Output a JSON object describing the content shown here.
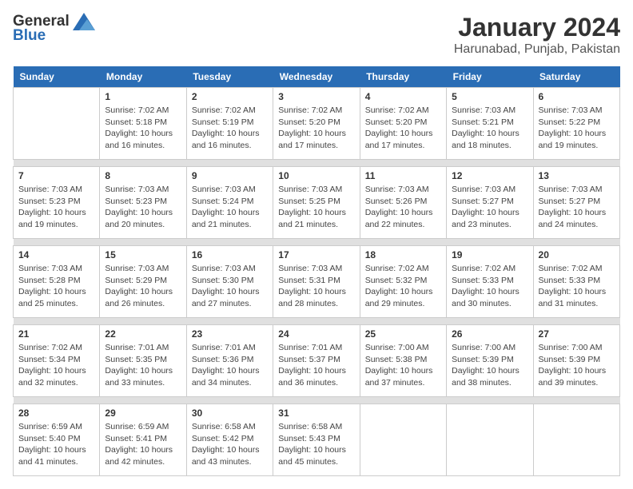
{
  "logo": {
    "general": "General",
    "blue": "Blue"
  },
  "title": "January 2024",
  "subtitle": "Harunabad, Punjab, Pakistan",
  "days_header": [
    "Sunday",
    "Monday",
    "Tuesday",
    "Wednesday",
    "Thursday",
    "Friday",
    "Saturday"
  ],
  "weeks": [
    {
      "days": [
        {
          "num": "",
          "info": ""
        },
        {
          "num": "1",
          "info": "Sunrise: 7:02 AM\nSunset: 5:18 PM\nDaylight: 10 hours\nand 16 minutes."
        },
        {
          "num": "2",
          "info": "Sunrise: 7:02 AM\nSunset: 5:19 PM\nDaylight: 10 hours\nand 16 minutes."
        },
        {
          "num": "3",
          "info": "Sunrise: 7:02 AM\nSunset: 5:20 PM\nDaylight: 10 hours\nand 17 minutes."
        },
        {
          "num": "4",
          "info": "Sunrise: 7:02 AM\nSunset: 5:20 PM\nDaylight: 10 hours\nand 17 minutes."
        },
        {
          "num": "5",
          "info": "Sunrise: 7:03 AM\nSunset: 5:21 PM\nDaylight: 10 hours\nand 18 minutes."
        },
        {
          "num": "6",
          "info": "Sunrise: 7:03 AM\nSunset: 5:22 PM\nDaylight: 10 hours\nand 19 minutes."
        }
      ]
    },
    {
      "days": [
        {
          "num": "7",
          "info": "Sunrise: 7:03 AM\nSunset: 5:23 PM\nDaylight: 10 hours\nand 19 minutes."
        },
        {
          "num": "8",
          "info": "Sunrise: 7:03 AM\nSunset: 5:23 PM\nDaylight: 10 hours\nand 20 minutes."
        },
        {
          "num": "9",
          "info": "Sunrise: 7:03 AM\nSunset: 5:24 PM\nDaylight: 10 hours\nand 21 minutes."
        },
        {
          "num": "10",
          "info": "Sunrise: 7:03 AM\nSunset: 5:25 PM\nDaylight: 10 hours\nand 21 minutes."
        },
        {
          "num": "11",
          "info": "Sunrise: 7:03 AM\nSunset: 5:26 PM\nDaylight: 10 hours\nand 22 minutes."
        },
        {
          "num": "12",
          "info": "Sunrise: 7:03 AM\nSunset: 5:27 PM\nDaylight: 10 hours\nand 23 minutes."
        },
        {
          "num": "13",
          "info": "Sunrise: 7:03 AM\nSunset: 5:27 PM\nDaylight: 10 hours\nand 24 minutes."
        }
      ]
    },
    {
      "days": [
        {
          "num": "14",
          "info": "Sunrise: 7:03 AM\nSunset: 5:28 PM\nDaylight: 10 hours\nand 25 minutes."
        },
        {
          "num": "15",
          "info": "Sunrise: 7:03 AM\nSunset: 5:29 PM\nDaylight: 10 hours\nand 26 minutes."
        },
        {
          "num": "16",
          "info": "Sunrise: 7:03 AM\nSunset: 5:30 PM\nDaylight: 10 hours\nand 27 minutes."
        },
        {
          "num": "17",
          "info": "Sunrise: 7:03 AM\nSunset: 5:31 PM\nDaylight: 10 hours\nand 28 minutes."
        },
        {
          "num": "18",
          "info": "Sunrise: 7:02 AM\nSunset: 5:32 PM\nDaylight: 10 hours\nand 29 minutes."
        },
        {
          "num": "19",
          "info": "Sunrise: 7:02 AM\nSunset: 5:33 PM\nDaylight: 10 hours\nand 30 minutes."
        },
        {
          "num": "20",
          "info": "Sunrise: 7:02 AM\nSunset: 5:33 PM\nDaylight: 10 hours\nand 31 minutes."
        }
      ]
    },
    {
      "days": [
        {
          "num": "21",
          "info": "Sunrise: 7:02 AM\nSunset: 5:34 PM\nDaylight: 10 hours\nand 32 minutes."
        },
        {
          "num": "22",
          "info": "Sunrise: 7:01 AM\nSunset: 5:35 PM\nDaylight: 10 hours\nand 33 minutes."
        },
        {
          "num": "23",
          "info": "Sunrise: 7:01 AM\nSunset: 5:36 PM\nDaylight: 10 hours\nand 34 minutes."
        },
        {
          "num": "24",
          "info": "Sunrise: 7:01 AM\nSunset: 5:37 PM\nDaylight: 10 hours\nand 36 minutes."
        },
        {
          "num": "25",
          "info": "Sunrise: 7:00 AM\nSunset: 5:38 PM\nDaylight: 10 hours\nand 37 minutes."
        },
        {
          "num": "26",
          "info": "Sunrise: 7:00 AM\nSunset: 5:39 PM\nDaylight: 10 hours\nand 38 minutes."
        },
        {
          "num": "27",
          "info": "Sunrise: 7:00 AM\nSunset: 5:39 PM\nDaylight: 10 hours\nand 39 minutes."
        }
      ]
    },
    {
      "days": [
        {
          "num": "28",
          "info": "Sunrise: 6:59 AM\nSunset: 5:40 PM\nDaylight: 10 hours\nand 41 minutes."
        },
        {
          "num": "29",
          "info": "Sunrise: 6:59 AM\nSunset: 5:41 PM\nDaylight: 10 hours\nand 42 minutes."
        },
        {
          "num": "30",
          "info": "Sunrise: 6:58 AM\nSunset: 5:42 PM\nDaylight: 10 hours\nand 43 minutes."
        },
        {
          "num": "31",
          "info": "Sunrise: 6:58 AM\nSunset: 5:43 PM\nDaylight: 10 hours\nand 45 minutes."
        },
        {
          "num": "",
          "info": ""
        },
        {
          "num": "",
          "info": ""
        },
        {
          "num": "",
          "info": ""
        }
      ]
    }
  ]
}
